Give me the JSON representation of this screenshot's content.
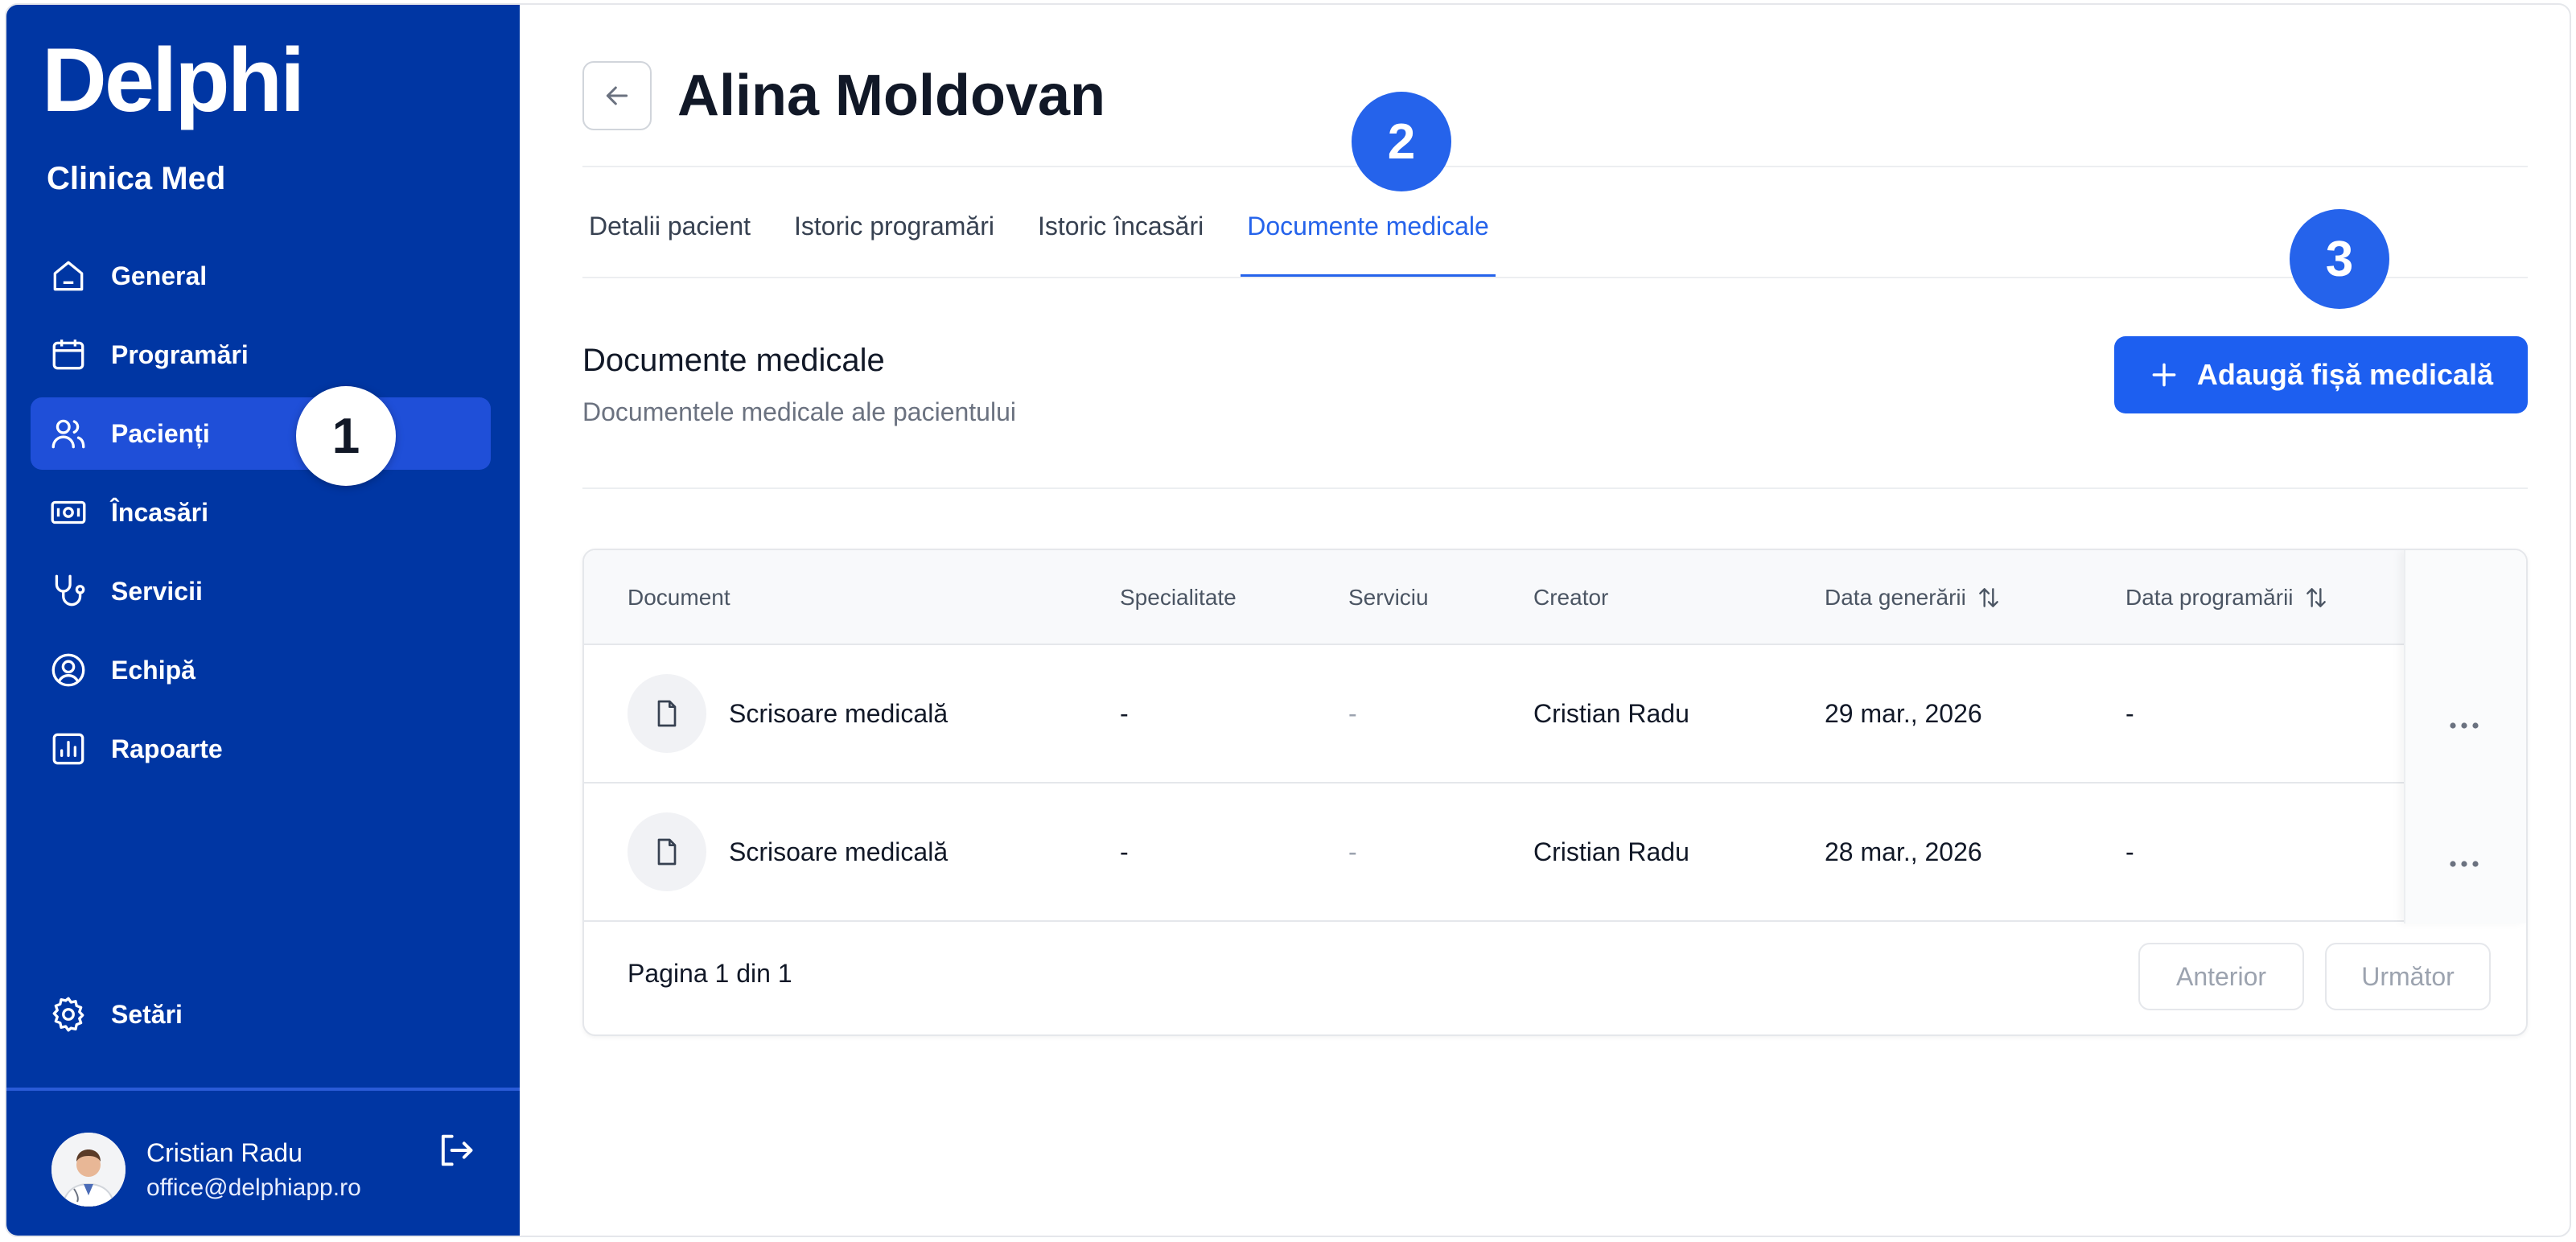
{
  "sidebar": {
    "logo": "Delphi",
    "clinic": "Clinica Med",
    "items": [
      {
        "label": "General",
        "icon": "home-icon"
      },
      {
        "label": "Programări",
        "icon": "calendar-icon"
      },
      {
        "label": "Pacienți",
        "icon": "users-icon",
        "active": true
      },
      {
        "label": "Încasări",
        "icon": "money-icon"
      },
      {
        "label": "Servicii",
        "icon": "stethoscope-icon"
      },
      {
        "label": "Echipă",
        "icon": "user-circle-icon"
      },
      {
        "label": "Rapoarte",
        "icon": "chart-icon"
      }
    ],
    "settings_label": "Setări",
    "user": {
      "name": "Cristian Radu",
      "email": "office@delphiapp.ro"
    }
  },
  "badges": [
    "1",
    "2",
    "3"
  ],
  "header": {
    "patient_name": "Alina Moldovan"
  },
  "tabs": [
    {
      "label": "Detalii pacient"
    },
    {
      "label": "Istoric programări"
    },
    {
      "label": "Istoric încasări"
    },
    {
      "label": "Documente medicale",
      "active": true
    }
  ],
  "section": {
    "title": "Documente medicale",
    "subtitle": "Documentele medicale ale pacientului",
    "add_button": "Adaugă fișă medicală"
  },
  "table": {
    "columns": [
      "Document",
      "Specialitate",
      "Serviciu",
      "Creator",
      "Data generării",
      "Data programării"
    ],
    "rows": [
      {
        "document": "Scrisoare medicală",
        "specialty": "-",
        "service": "-",
        "creator": "Cristian Radu",
        "generated": "29 mar., 2026",
        "appointment": "-"
      },
      {
        "document": "Scrisoare medicală",
        "specialty": "-",
        "service": "-",
        "creator": "Cristian Radu",
        "generated": "28 mar., 2026",
        "appointment": "-"
      }
    ],
    "pagination": {
      "text": "Pagina 1 din 1",
      "prev": "Anterior",
      "next": "Următor"
    }
  },
  "colors": {
    "sidebar_bg": "#0036a3",
    "accent": "#2563eb",
    "active_nav": "#1f4fd8"
  }
}
